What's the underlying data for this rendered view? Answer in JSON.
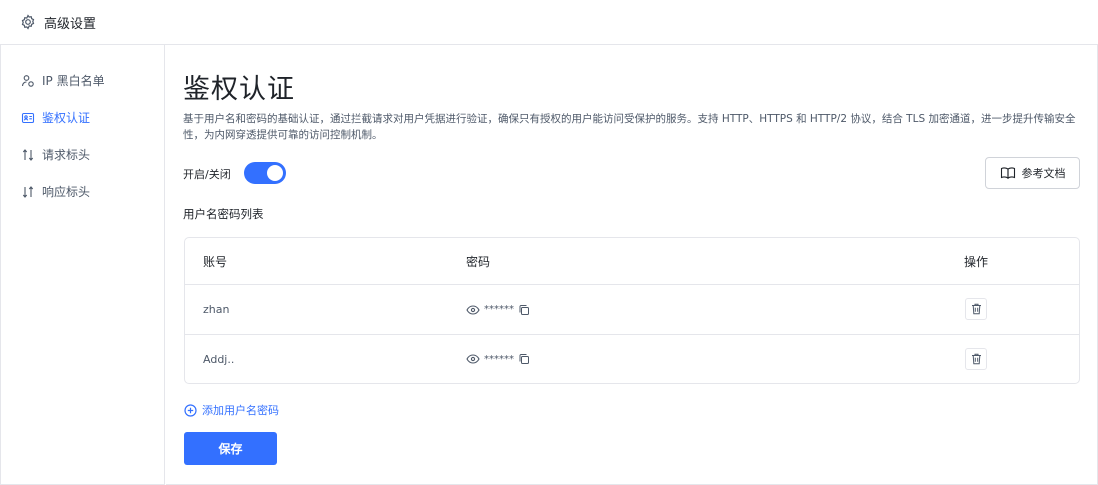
{
  "header": {
    "title": "高级设置",
    "icon": "gear-icon"
  },
  "sidebar": {
    "items": [
      {
        "label": "IP 黑白名单",
        "icon": "user-filter-icon",
        "active": false
      },
      {
        "label": "鉴权认证",
        "icon": "id-card-icon",
        "active": true
      },
      {
        "label": "请求标头",
        "icon": "sort-arrows-icon",
        "active": false
      },
      {
        "label": "响应标头",
        "icon": "swap-arrows-icon",
        "active": false
      }
    ]
  },
  "main": {
    "title": "鉴权认证",
    "description": "基于用户名和密码的基础认证，通过拦截请求对用户凭据进行验证，确保只有授权的用户能访问受保护的服务。支持 HTTP、HTTPS 和 HTTP/2 协议，结合 TLS 加密通道，进一步提升传输安全性，为内网穿透提供可靠的访问控制机制。",
    "toggle": {
      "label": "开启/关闭",
      "on": true
    },
    "doc_button": "参考文档",
    "list_title": "用户名密码列表",
    "table": {
      "headers": {
        "account": "账号",
        "password": "密码",
        "action": "操作"
      },
      "rows": [
        {
          "account": "zhan",
          "password": "******"
        },
        {
          "account": "Addj..",
          "password": "******"
        }
      ]
    },
    "add_link": "添加用户名密码",
    "save_button": "保存"
  },
  "colors": {
    "accent": "#3370ff",
    "border": "#e5e6eb",
    "text": "#1f2329",
    "muted": "#4e5969"
  }
}
